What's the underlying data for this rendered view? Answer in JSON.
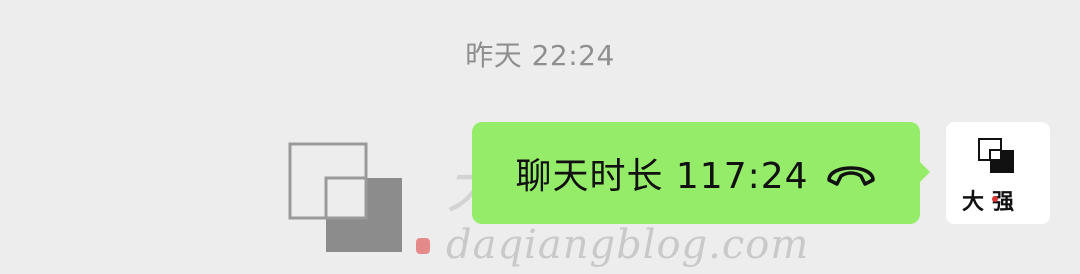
{
  "timestamp": "昨天 22:24",
  "message": {
    "text": "聊天时长 117:24",
    "icon": "phone-hangup-icon",
    "bubble_color": "#95ec69"
  },
  "avatar": {
    "label": "大强"
  },
  "watermark": {
    "brand": "大强博客",
    "url": "daqiangblog.com"
  }
}
